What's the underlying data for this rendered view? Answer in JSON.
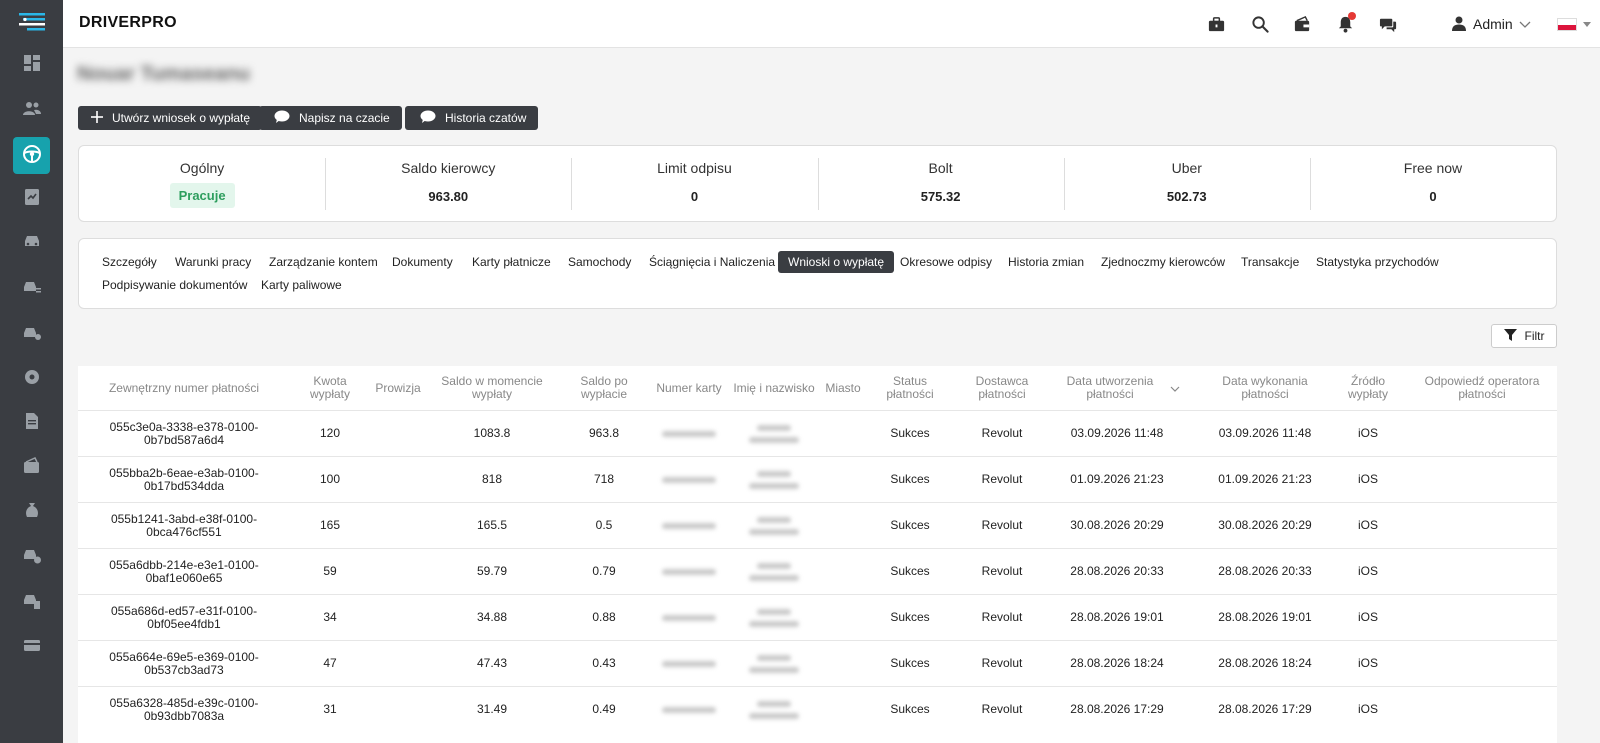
{
  "app": {
    "brand": "DRIVERPRO",
    "user": "Admin"
  },
  "driver": {
    "name": "Nouar Tumaseanu"
  },
  "actions": [
    {
      "label": "Utwórz wniosek o wypłatę",
      "icon": "plus-icon"
    },
    {
      "label": "Napisz na czacie",
      "icon": "chat-icon"
    },
    {
      "label": "Historia czatów",
      "icon": "chat-icon"
    }
  ],
  "stats": {
    "general_label": "Ogólny",
    "general_status": "Pracuje",
    "items": [
      {
        "label": "Saldo kierowcy",
        "value": "963.80"
      },
      {
        "label": "Limit odpisu",
        "value": "0"
      },
      {
        "label": "Bolt",
        "value": "575.32"
      },
      {
        "label": "Uber",
        "value": "502.73"
      },
      {
        "label": "Free now",
        "value": "0"
      }
    ]
  },
  "tabs": [
    "Szczegóły",
    "Warunki pracy",
    "Zarządzanie kontem",
    "Dokumenty",
    "Karty płatnicze",
    "Samochody",
    "Ściągnięcia i Naliczenia",
    "Wnioski o wypłatę",
    "Okresowe odpisy",
    "Historia zmian",
    "Zjednoczmy kierowców",
    "Transakcje",
    "Statystyka przychodów",
    "Podpisywanie dokumentów",
    "Karty paliwowe"
  ],
  "active_tab": "Wnioski o wypłatę",
  "filter_label": "Filtr",
  "columns": [
    "Zewnętrzny numer płatności",
    "Kwota wypłaty",
    "Prowizja",
    "Saldo w momencie wypłaty",
    "Saldo po wypłacie",
    "Numer karty",
    "Imię i nazwisko",
    "Miasto",
    "Status płatności",
    "Dostawca płatności",
    "Data utworzenia płatności",
    "Data wykonania płatności",
    "Źródło wypłaty",
    "Odpowiedź operatora płatności"
  ],
  "rows": [
    {
      "id": "055c3e0a-3338-e378-0100-0b7bd587a6d4",
      "amount": "120",
      "commission": "",
      "balance_at": "1083.8",
      "balance_after": "963.8",
      "city": "",
      "status": "Sukces",
      "provider": "Revolut",
      "created": "03.09.2026 11:48",
      "executed": "03.09.2026 11:48",
      "source": "iOS",
      "operator_response": ""
    },
    {
      "id": "055bba2b-6eae-e3ab-0100-0b17bd534dda",
      "amount": "100",
      "commission": "",
      "balance_at": "818",
      "balance_after": "718",
      "city": "",
      "status": "Sukces",
      "provider": "Revolut",
      "created": "01.09.2026 21:23",
      "executed": "01.09.2026 21:23",
      "source": "iOS",
      "operator_response": ""
    },
    {
      "id": "055b1241-3abd-e38f-0100-0bca476cf551",
      "amount": "165",
      "commission": "",
      "balance_at": "165.5",
      "balance_after": "0.5",
      "city": "",
      "status": "Sukces",
      "provider": "Revolut",
      "created": "30.08.2026 20:29",
      "executed": "30.08.2026 20:29",
      "source": "iOS",
      "operator_response": ""
    },
    {
      "id": "055a6dbb-214e-e3e1-0100-0baf1e060e65",
      "amount": "59",
      "commission": "",
      "balance_at": "59.79",
      "balance_after": "0.79",
      "city": "",
      "status": "Sukces",
      "provider": "Revolut",
      "created": "28.08.2026 20:33",
      "executed": "28.08.2026 20:33",
      "source": "iOS",
      "operator_response": ""
    },
    {
      "id": "055a686d-ed57-e31f-0100-0bf05ee4fdb1",
      "amount": "34",
      "commission": "",
      "balance_at": "34.88",
      "balance_after": "0.88",
      "city": "",
      "status": "Sukces",
      "provider": "Revolut",
      "created": "28.08.2026 19:01",
      "executed": "28.08.2026 19:01",
      "source": "iOS",
      "operator_response": ""
    },
    {
      "id": "055a664e-69e5-e369-0100-0b537cb3ad73",
      "amount": "47",
      "commission": "",
      "balance_at": "47.43",
      "balance_after": "0.43",
      "city": "",
      "status": "Sukces",
      "provider": "Revolut",
      "created": "28.08.2026 18:24",
      "executed": "28.08.2026 18:24",
      "source": "iOS",
      "operator_response": ""
    },
    {
      "id": "055a6328-485d-e39c-0100-0b93dbb7083a",
      "amount": "31",
      "commission": "",
      "balance_at": "31.49",
      "balance_after": "0.49",
      "city": "",
      "status": "Sukces",
      "provider": "Revolut",
      "created": "28.08.2026 17:29",
      "executed": "28.08.2026 17:29",
      "source": "iOS",
      "operator_response": ""
    }
  ],
  "sidebar": {
    "items": [
      "dashboard-icon",
      "users-icon",
      "steering-wheel-icon",
      "reports-icon",
      "car-icon",
      "car-list-icon",
      "car-settings-icon",
      "settings-icon",
      "document-icon",
      "wallet-icon",
      "money-bag-icon",
      "car-money-icon",
      "car-document-icon",
      "credit-card-icon"
    ],
    "active": "steering-wheel-icon"
  },
  "colors": {
    "sidebar": "#3a3d42",
    "accent": "#17a2ad",
    "success_bg": "#e3f6ec",
    "success_text": "#2e9e5e",
    "notification": "#e53935"
  }
}
